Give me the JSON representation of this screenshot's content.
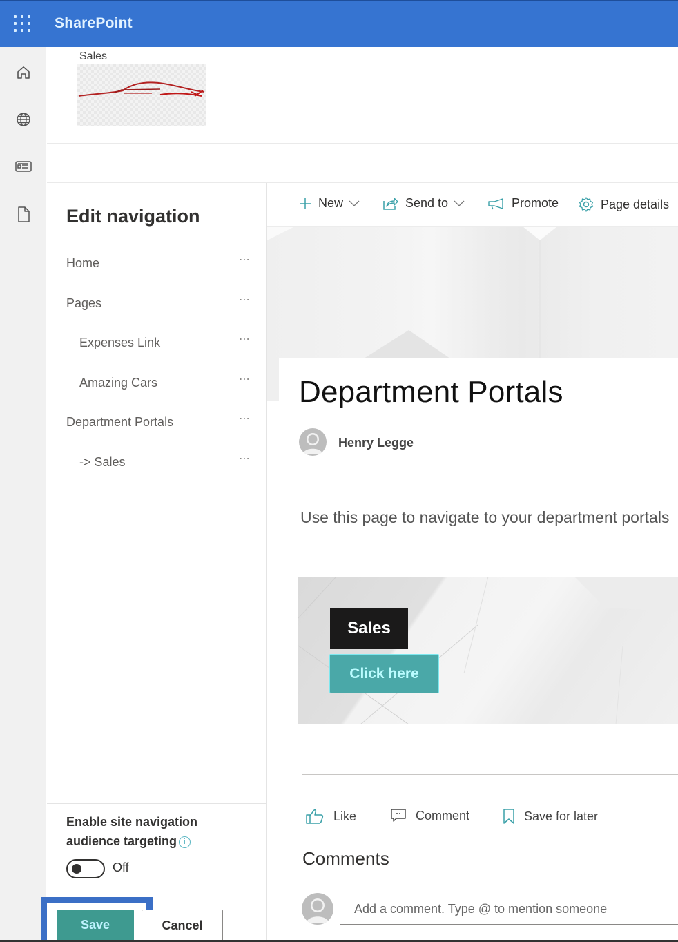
{
  "app": {
    "brand": "SharePoint",
    "accent_color": "#3674d1"
  },
  "rail": {
    "items": [
      {
        "name": "home",
        "icon": "home-icon"
      },
      {
        "name": "sites",
        "icon": "globe-icon"
      },
      {
        "name": "news",
        "icon": "news-icon"
      },
      {
        "name": "files",
        "icon": "document-icon"
      }
    ]
  },
  "site": {
    "name": "Sales",
    "logo": "car-silhouette-logo"
  },
  "nav_panel": {
    "title": "Edit navigation",
    "items": [
      {
        "label": "Home",
        "level": 0,
        "more": "⋯"
      },
      {
        "label": "Pages",
        "level": 0,
        "more": "⋯"
      },
      {
        "label": "Expenses Link",
        "level": 1,
        "more": "⋯"
      },
      {
        "label": "Amazing Cars",
        "level": 1,
        "more": "⋯"
      },
      {
        "label": "Department Portals",
        "level": 0,
        "more": "⋯"
      },
      {
        "label": "-> Sales",
        "level": 1,
        "more": "⋯"
      }
    ],
    "audience_label": "Enable site navigation audience targeting",
    "info_glyph": "i",
    "toggle_state": "Off",
    "save_label": "Save",
    "cancel_label": "Cancel"
  },
  "command_bar": {
    "new_label": "New",
    "send_to_label": "Send to",
    "promote_label": "Promote",
    "page_details_label": "Page details"
  },
  "page": {
    "title": "Department Portals",
    "author": "Henry Legge",
    "intro": "Use this page to navigate to your department portals",
    "hero": {
      "title": "Sales",
      "button_label": "Click here",
      "button_color": "#4aa8a8"
    }
  },
  "social": {
    "like_label": "Like",
    "comment_label": "Comment",
    "save_label": "Save for later"
  },
  "comments": {
    "heading": "Comments",
    "placeholder": "Add a comment. Type @ to mention someone"
  }
}
